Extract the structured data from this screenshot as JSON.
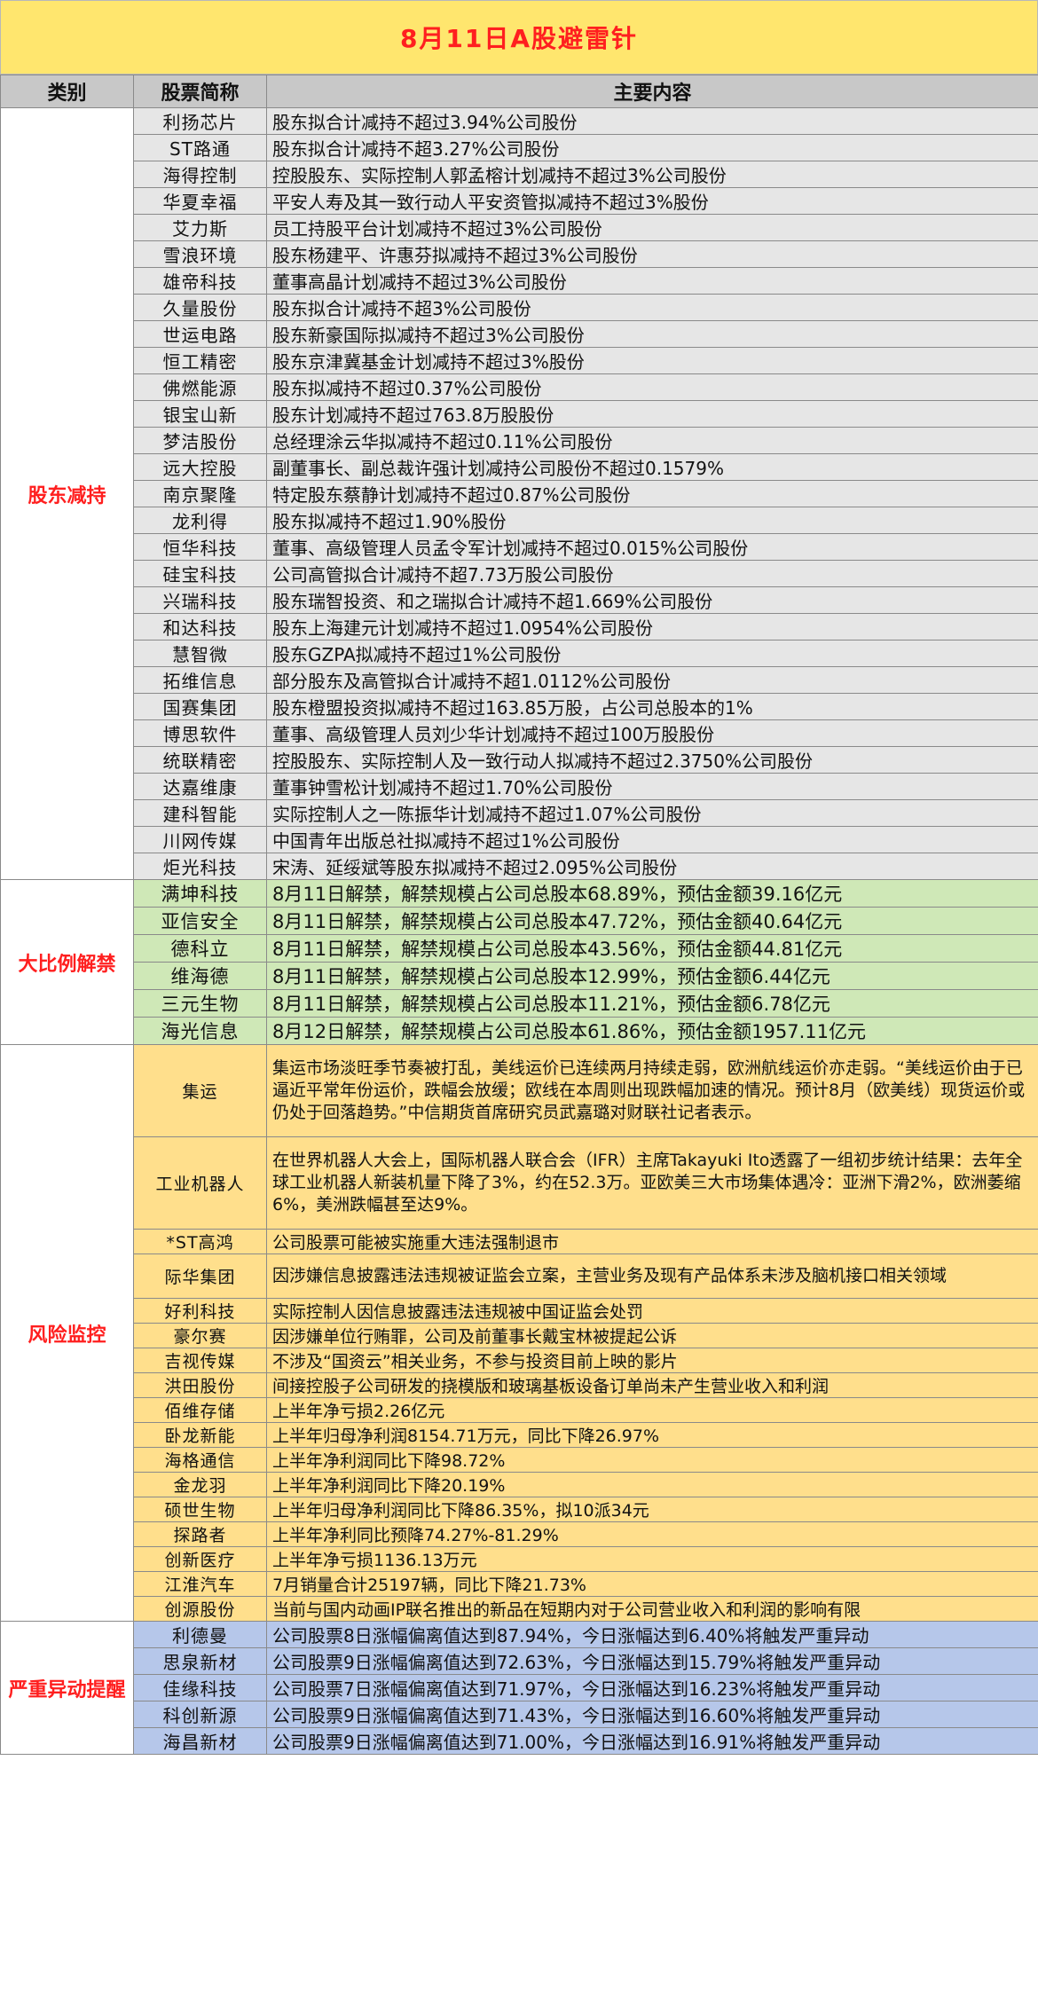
{
  "title": "8月11日A股避雷针",
  "headers": {
    "category": "类别",
    "stock": "股票简称",
    "content": "主要内容"
  },
  "groups": [
    {
      "category": "股东减持",
      "rows": [
        {
          "name": "利扬芯片",
          "content": "股东拟合计减持不超过3.94%公司股份"
        },
        {
          "name": "ST路通",
          "content": "股东拟合计减持不超3.27%公司股份"
        },
        {
          "name": "海得控制",
          "content": "控股股东、实际控制人郭孟榕计划减持不超过3%公司股份"
        },
        {
          "name": "华夏幸福",
          "content": "平安人寿及其一致行动人平安资管拟减持不超过3%股份"
        },
        {
          "name": "艾力斯",
          "content": "员工持股平台计划减持不超过3%公司股份"
        },
        {
          "name": "雪浪环境",
          "content": "股东杨建平、许惠芬拟减持不超过3%公司股份"
        },
        {
          "name": "雄帝科技",
          "content": "董事高晶计划减持不超过3%公司股份"
        },
        {
          "name": "久量股份",
          "content": "股东拟合计减持不超3%公司股份"
        },
        {
          "name": "世运电路",
          "content": "股东新豪国际拟减持不超过3%公司股份"
        },
        {
          "name": "恒工精密",
          "content": "股东京津冀基金计划减持不超过3%股份"
        },
        {
          "name": "佛燃能源",
          "content": "股东拟减持不超过0.37%公司股份"
        },
        {
          "name": "银宝山新",
          "content": "股东计划减持不超过763.8万股股份"
        },
        {
          "name": "梦洁股份",
          "content": "总经理涂云华拟减持不超过0.11%公司股份"
        },
        {
          "name": "远大控股",
          "content": "副董事长、副总裁许强计划减持公司股份不超过0.1579%"
        },
        {
          "name": "南京聚隆",
          "content": "特定股东蔡静计划减持不超过0.87%公司股份"
        },
        {
          "name": "龙利得",
          "content": "股东拟减持不超过1.90%股份"
        },
        {
          "name": "恒华科技",
          "content": "董事、高级管理人员孟令军计划减持不超过0.015%公司股份"
        },
        {
          "name": "硅宝科技",
          "content": "公司高管拟合计减持不超7.73万股公司股份"
        },
        {
          "name": "兴瑞科技",
          "content": "股东瑞智投资、和之瑞拟合计减持不超1.669%公司股份"
        },
        {
          "name": "和达科技",
          "content": "股东上海建元计划减持不超过1.0954%公司股份"
        },
        {
          "name": "慧智微",
          "content": "股东GZPA拟减持不超过1%公司股份"
        },
        {
          "name": "拓维信息",
          "content": "部分股东及高管拟合计减持不超1.0112%公司股份"
        },
        {
          "name": "国赛集团",
          "content": "股东橙盟投资拟减持不超过163.85万股，占公司总股本的1%"
        },
        {
          "name": "博思软件",
          "content": "董事、高级管理人员刘少华计划减持不超过100万股股份"
        },
        {
          "name": "统联精密",
          "content": "控股股东、实际控制人及一致行动人拟减持不超过2.3750%公司股份"
        },
        {
          "name": "达嘉维康",
          "content": "董事钟雪松计划减持不超过1.70%公司股份"
        },
        {
          "name": "建科智能",
          "content": "实际控制人之一陈振华计划减持不超过1.07%公司股份"
        },
        {
          "name": "川网传媒",
          "content": "中国青年出版总社拟减持不超过1%公司股份"
        },
        {
          "name": "炬光科技",
          "content": "宋涛、延绥斌等股东拟减持不超过2.095%公司股份"
        }
      ]
    },
    {
      "category": "大比例解禁",
      "rows": [
        {
          "name": "满坤科技",
          "content": "8月11日解禁，解禁规模占公司总股本68.89%，预估金额39.16亿元"
        },
        {
          "name": "亚信安全",
          "content": "8月11日解禁，解禁规模占公司总股本47.72%，预估金额40.64亿元"
        },
        {
          "name": "德科立",
          "content": "8月11日解禁，解禁规模占公司总股本43.56%，预估金额44.81亿元"
        },
        {
          "name": "维海德",
          "content": "8月11日解禁，解禁规模占公司总股本12.99%，预估金额6.44亿元"
        },
        {
          "name": "三元生物",
          "content": "8月11日解禁，解禁规模占公司总股本11.21%，预估金额6.78亿元"
        },
        {
          "name": "海光信息",
          "content": "8月12日解禁，解禁规模占公司总股本61.86%，预估金额1957.11亿元"
        }
      ]
    },
    {
      "category": "风险监控",
      "rows": [
        {
          "name": "集运",
          "content": "集运市场淡旺季节奏被打乱，美线运价已连续两月持续走弱，欧洲航线运价亦走弱。“美线运价由于已逼近平常年份运价，跌幅会放缓；欧线在本周则出现跌幅加速的情况。预计8月（欧美线）现货运价或仍处于回落趋势。”中信期货首席研究员武嘉璐对财联社记者表示。"
        },
        {
          "name": "工业机器人",
          "content": "在世界机器人大会上，国际机器人联合会（IFR）主席Takayuki Ito透露了一组初步统计结果：去年全球工业机器人新装机量下降了3%，约在52.3万。亚欧美三大市场集体遇冷：亚洲下滑2%，欧洲萎缩6%，美洲跌幅甚至达9%。"
        },
        {
          "name": "*ST高鸿",
          "content": "公司股票可能被实施重大违法强制退市"
        },
        {
          "name": "际华集团",
          "content": "因涉嫌信息披露违法违规被证监会立案，主营业务及现有产品体系未涉及脑机接口相关领域"
        },
        {
          "name": "好利科技",
          "content": "实际控制人因信息披露违法违规被中国证监会处罚"
        },
        {
          "name": "豪尔赛",
          "content": "因涉嫌单位行贿罪，公司及前董事长戴宝林被提起公诉"
        },
        {
          "name": "吉视传媒",
          "content": "不涉及“国资云”相关业务，不参与投资目前上映的影片"
        },
        {
          "name": "洪田股份",
          "content": "间接控股子公司研发的挠模版和玻璃基板设备订单尚未产生营业收入和利润"
        },
        {
          "name": "佰维存储",
          "content": "上半年净亏损2.26亿元"
        },
        {
          "name": "卧龙新能",
          "content": "上半年归母净利润8154.71万元，同比下降26.97%"
        },
        {
          "name": "海格通信",
          "content": "上半年净利润同比下降98.72%"
        },
        {
          "name": "金龙羽",
          "content": "上半年净利润同比下降20.19%"
        },
        {
          "name": "硕世生物",
          "content": "上半年归母净利润同比下降86.35%，拟10派34元"
        },
        {
          "name": "探路者",
          "content": "上半年净利同比预降74.27%-81.29%"
        },
        {
          "name": "创新医疗",
          "content": "上半年净亏损1136.13万元"
        },
        {
          "name": "江淮汽车",
          "content": "7月销量合计25197辆，同比下降21.73%"
        },
        {
          "name": "创源股份",
          "content": "当前与国内动画IP联名推出的新品在短期内对于公司营业收入和利润的影响有限"
        }
      ]
    },
    {
      "category": "严重异动提醒",
      "rows": [
        {
          "name": "利德曼",
          "content": "公司股票8日涨幅偏离值达到87.94%，今日涨幅达到6.40%将触发严重异动"
        },
        {
          "name": "思泉新材",
          "content": "公司股票9日涨幅偏离值达到72.63%，今日涨幅达到15.79%将触发严重异动"
        },
        {
          "name": "佳缘科技",
          "content": "公司股票7日涨幅偏离值达到71.97%，今日涨幅达到16.23%将触发严重异动"
        },
        {
          "name": "科创新源",
          "content": "公司股票9日涨幅偏离值达到71.43%，今日涨幅达到16.60%将触发严重异动"
        },
        {
          "name": "海昌新材",
          "content": "公司股票9日涨幅偏离值达到71.00%，今日涨幅达到16.91%将触发严重异动"
        }
      ]
    }
  ]
}
